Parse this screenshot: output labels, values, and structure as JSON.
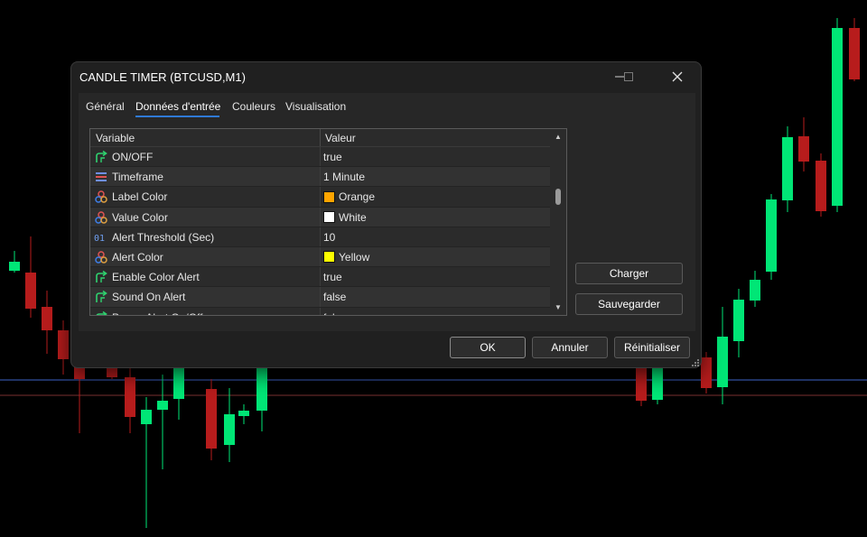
{
  "dialog": {
    "title": "CANDLE TIMER (BTCUSD,M1)",
    "window_controls": [
      "minimize-icon",
      "maximize-icon",
      "close-icon"
    ]
  },
  "tabs": [
    {
      "label": "Général",
      "active": false
    },
    {
      "label": "Données d'entrée",
      "active": true
    },
    {
      "label": "Couleurs",
      "active": false
    },
    {
      "label": "Visualisation",
      "active": false
    }
  ],
  "grid": {
    "headers": {
      "variable": "Variable",
      "value": "Valeur"
    },
    "rows": [
      {
        "icon": "toggle-arrow-icon",
        "name": "ON/OFF",
        "value": "true"
      },
      {
        "icon": "enum-list-icon",
        "name": "Timeframe",
        "value": "1 Minute"
      },
      {
        "icon": "color-circles-icon",
        "name": "Label Color",
        "value": "Orange",
        "swatch": "#ffa500"
      },
      {
        "icon": "color-circles-icon",
        "name": "Value Color",
        "value": "White",
        "swatch": "#ffffff"
      },
      {
        "icon": "integer-icon",
        "name": "Alert Threshold (Sec)",
        "value": "10"
      },
      {
        "icon": "color-circles-icon",
        "name": "Alert Color",
        "value": "Yellow",
        "swatch": "#ffff00"
      },
      {
        "icon": "toggle-arrow-icon",
        "name": "Enable Color Alert",
        "value": "true"
      },
      {
        "icon": "toggle-arrow-icon",
        "name": "Sound On Alert",
        "value": "false"
      },
      {
        "icon": "toggle-arrow-icon",
        "name": "Popup Alert On/Off",
        "value": "false"
      }
    ]
  },
  "side_buttons": {
    "load": "Charger",
    "save": "Sauvegarder"
  },
  "footer_buttons": {
    "ok": "OK",
    "cancel": "Annuler",
    "reset": "Réinitialiser"
  },
  "colors": {
    "bull_candle": "#00e676",
    "bear_candle": "#b71c1c",
    "accent": "#2f7ad6",
    "line_blue": "#2962ff",
    "line_red": "#8b2a2a"
  }
}
